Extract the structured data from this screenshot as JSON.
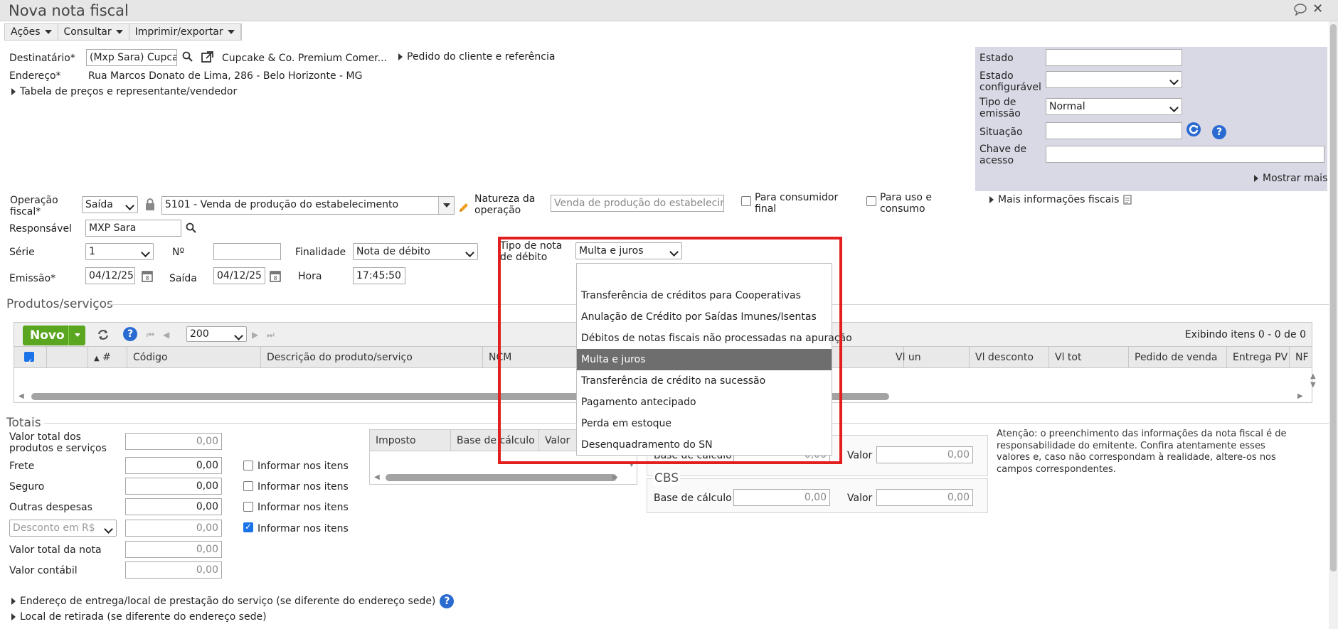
{
  "window": {
    "title": "Nova nota fiscal"
  },
  "toolbar": {
    "acoes": "Ações",
    "consultar": "Consultar",
    "imprimir": "Imprimir/exportar"
  },
  "header": {
    "destinatario_label": "Destinatário*",
    "destinatario_value": "(Mxp Sara) Cupcake",
    "destinatario_name": "Cupcake & Co. Premium Comer...",
    "pedido_link": "Pedido do cliente e referência",
    "endereco_label": "Endereço*",
    "endereco_value": "Rua Marcos Donato de Lima, 286 - Belo Horizonte - MG",
    "tabela_link": "Tabela de preços e representante/vendedor"
  },
  "side": {
    "estado_label": "Estado",
    "estado_config_label": "Estado configurável",
    "tipo_emissao_label": "Tipo de emissão",
    "tipo_emissao_value": "Normal",
    "situacao_label": "Situação",
    "chave_label": "Chave de acesso",
    "mostrar_mais": "Mostrar mais"
  },
  "operacao": {
    "label": "Operação fiscal*",
    "tipo": "Saída",
    "cfop": "5101 - Venda de produção do estabelecimento",
    "natureza_label": "Natureza da operação",
    "natureza_value": "Venda de produção do estabelecimento",
    "consumidor_final": "Para consumidor final",
    "uso_consumo": "Para uso e consumo",
    "mais_info": "Mais informações fiscais"
  },
  "responsavel": {
    "label": "Responsável",
    "value": "MXP Sara"
  },
  "serie": {
    "label": "Série",
    "value": "1",
    "numero_label": "Nº",
    "finalidade_label": "Finalidade",
    "finalidade_value": "Nota de débito"
  },
  "tipo_debito": {
    "label": "Tipo de nota de débito",
    "value": "Multa e juros",
    "options": [
      "",
      "Transferência de créditos para Cooperativas",
      "Anulação de Crédito por Saídas Imunes/Isentas",
      "Débitos de notas fiscais não processadas na apuração",
      "Multa e juros",
      "Transferência de crédito na sucessão",
      "Pagamento antecipado",
      "Perda em estoque",
      "Desenquadramento do SN"
    ]
  },
  "datas": {
    "emissao_label": "Emissão*",
    "emissao_value": "04/12/25",
    "saida_label": "Saída",
    "saida_value": "04/12/25",
    "hora_label": "Hora",
    "hora_value": "17:45:50"
  },
  "produtos": {
    "title": "Produtos/serviços",
    "novo": "Novo",
    "page_size": "200",
    "exibindo": "Exibindo itens 0 - 0 de 0",
    "columns": [
      "#",
      "Código",
      "Descrição do produto/serviço",
      "NCM",
      "Vl un",
      "Vl desconto",
      "Vl tot",
      "Pedido de venda",
      "Entrega PV",
      "NF"
    ]
  },
  "totais": {
    "title": "Totais",
    "rows": [
      {
        "label": "Valor total dos produtos e serviços",
        "value": "0,00"
      },
      {
        "label": "Frete",
        "value": "0,00"
      },
      {
        "label": "Seguro",
        "value": "0,00"
      },
      {
        "label": "Outras despesas",
        "value": "0,00"
      },
      {
        "label": "Desconto em R$",
        "value": "0,00"
      },
      {
        "label": "Valor total da nota",
        "value": "0,00"
      },
      {
        "label": "Valor contábil",
        "value": "0,00"
      }
    ],
    "informar": "Informar nos itens"
  },
  "imposto_grid": {
    "columns": [
      "Imposto",
      "Base de cálculo",
      "Valor"
    ]
  },
  "ibs": {
    "base_label": "Base de cálculo",
    "base_value": "0,00",
    "valor_label": "Valor",
    "valor_value": "0,00"
  },
  "cbs": {
    "title": "CBS",
    "base_label": "Base de cálculo",
    "base_value": "0,00",
    "valor_label": "Valor",
    "valor_value": "0,00"
  },
  "aviso": "Atenção: o preenchimento das informações da nota fiscal é de responsabilidade do emitente. Confira atentamente esses valores e, caso não correspondam à realidade, altere-os nos campos correspondentes.",
  "footer": {
    "entrega": "Endereço de entrega/local de prestação do serviço (se diferente do endereço sede)",
    "retirada": "Local de retirada (se diferente do endereço sede)"
  },
  "colors": {
    "accent_green": "#5aa620",
    "highlight_red": "#e21e1e",
    "selected_gray": "#6e6e6e",
    "side_panel": "#d9d9e6"
  }
}
